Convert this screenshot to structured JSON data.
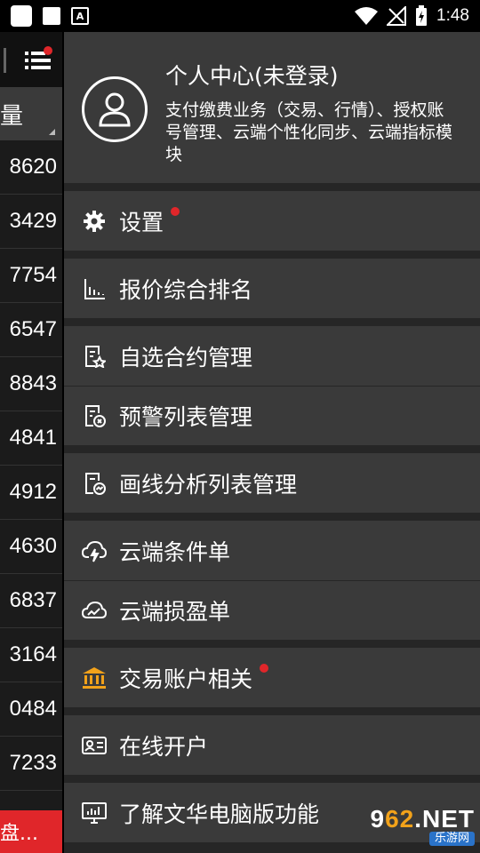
{
  "status_bar": {
    "time": "1:48",
    "a_icon": "A"
  },
  "background_list": {
    "header": "量",
    "rows": [
      "8620",
      "3429",
      "7754",
      "6547",
      "8843",
      "4841",
      "4912",
      "4630",
      "6837",
      "3164",
      "0484",
      "7233"
    ],
    "bottom_label": "盘..."
  },
  "profile": {
    "title": "个人中心(未登录)",
    "description": "支付缴费业务（交易、行情）、授权账号管理、云端个性化同步、云端指标模块"
  },
  "menu_groups": [
    [
      {
        "label": "设置",
        "icon": "gear-icon",
        "dot": true
      }
    ],
    [
      {
        "label": "报价综合排名",
        "icon": "bar-chart-icon",
        "dot": false
      }
    ],
    [
      {
        "label": "自选合约管理",
        "icon": "doc-star-icon",
        "dot": false
      },
      {
        "label": "预警列表管理",
        "icon": "doc-alert-icon",
        "dot": false
      }
    ],
    [
      {
        "label": "画线分析列表管理",
        "icon": "doc-chart-icon",
        "dot": false
      }
    ],
    [
      {
        "label": "云端条件单",
        "icon": "cloud-bolt-icon",
        "dot": false
      },
      {
        "label": "云端损盈单",
        "icon": "cloud-chart-icon",
        "dot": false
      }
    ],
    [
      {
        "label": "交易账户相关",
        "icon": "bank-icon",
        "dot": true
      }
    ],
    [
      {
        "label": "在线开户",
        "icon": "id-card-icon",
        "dot": false
      }
    ],
    [
      {
        "label": "了解文华电脑版功能",
        "icon": "monitor-icon",
        "dot": false
      }
    ]
  ],
  "watermark": {
    "main_left": "9",
    "main_accent": "62",
    "main_right": ".NET",
    "sub": "乐游网"
  },
  "colors": {
    "accent_red": "#e0262a",
    "bank_icon": "#f2a21a",
    "drawer_bg": "#262626",
    "item_bg": "#3a3a3a"
  }
}
